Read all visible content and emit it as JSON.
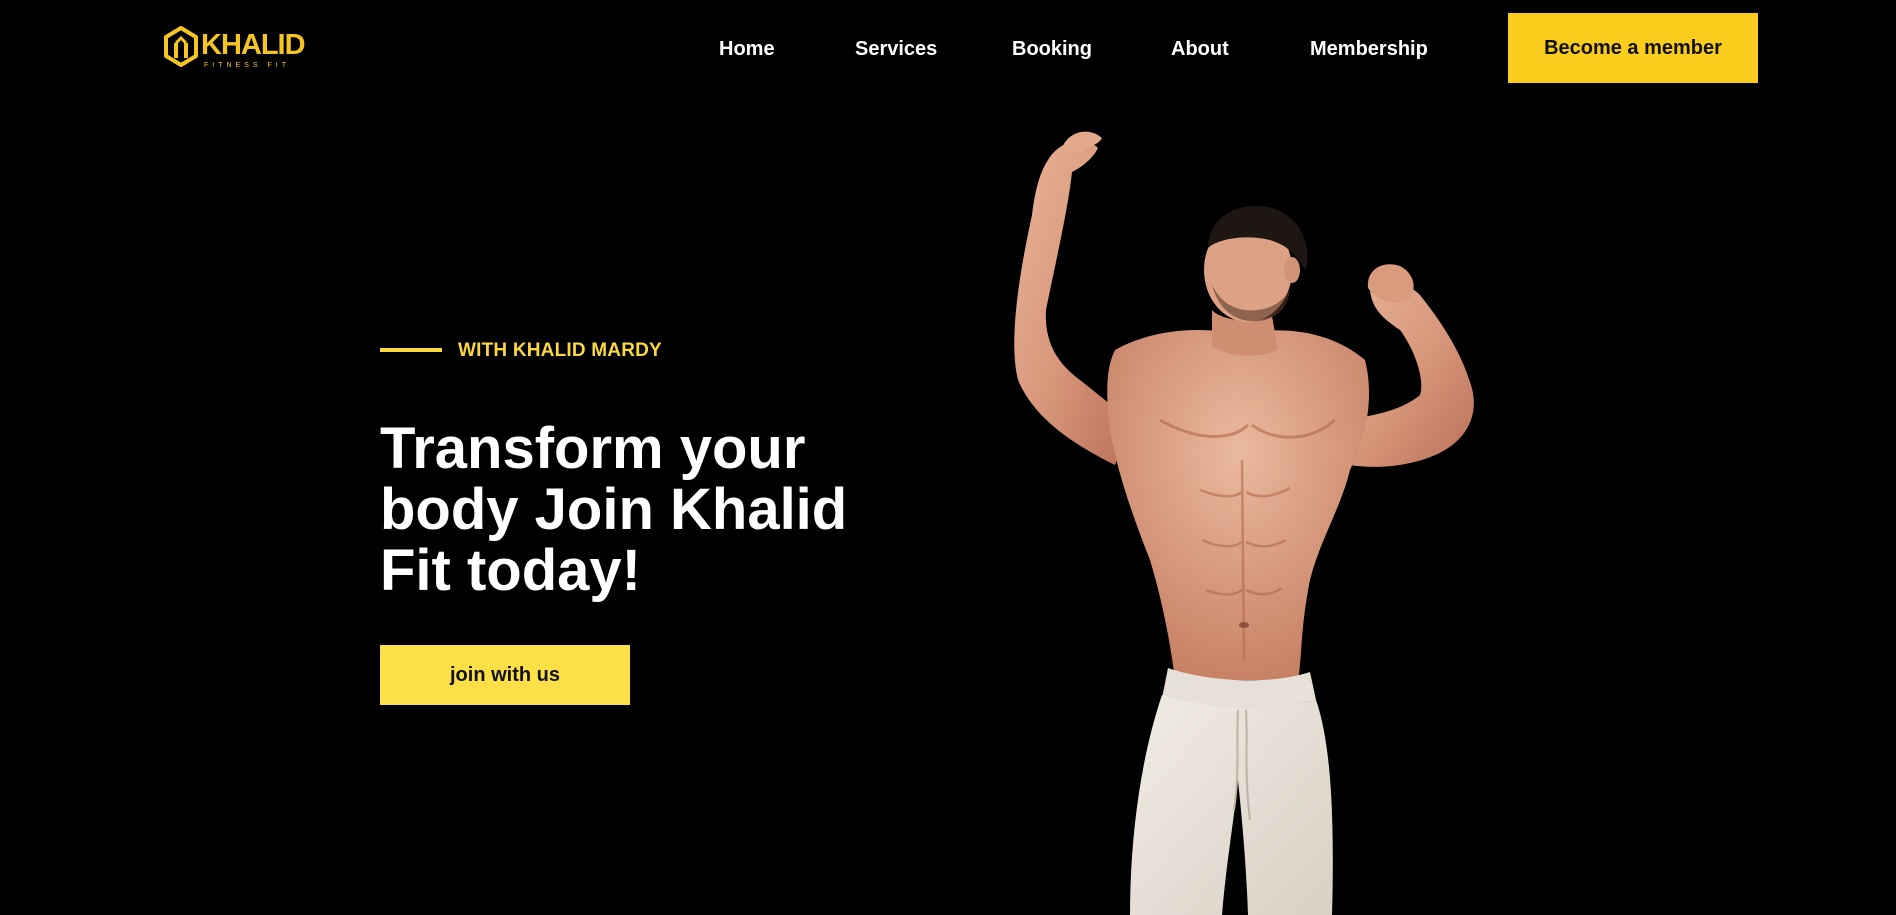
{
  "brand": {
    "name": "KHALID",
    "tagline": "FITNESS FIT",
    "color": "#f5c523"
  },
  "nav": {
    "items": [
      {
        "label": "Home"
      },
      {
        "label": "Services"
      },
      {
        "label": "Booking"
      },
      {
        "label": "About"
      },
      {
        "label": "Membership"
      }
    ],
    "cta_label": "Become a member"
  },
  "hero": {
    "eyebrow": "WITH KHALID MARDY",
    "title": "Transform your body Join Khalid Fit today!",
    "button_label": "join with us",
    "image_subject": "muscular man flexing arms, wearing white pants"
  },
  "colors": {
    "background": "#000000",
    "accent": "#fbcd1c",
    "accent_light": "#fde047",
    "text": "#ffffff"
  }
}
